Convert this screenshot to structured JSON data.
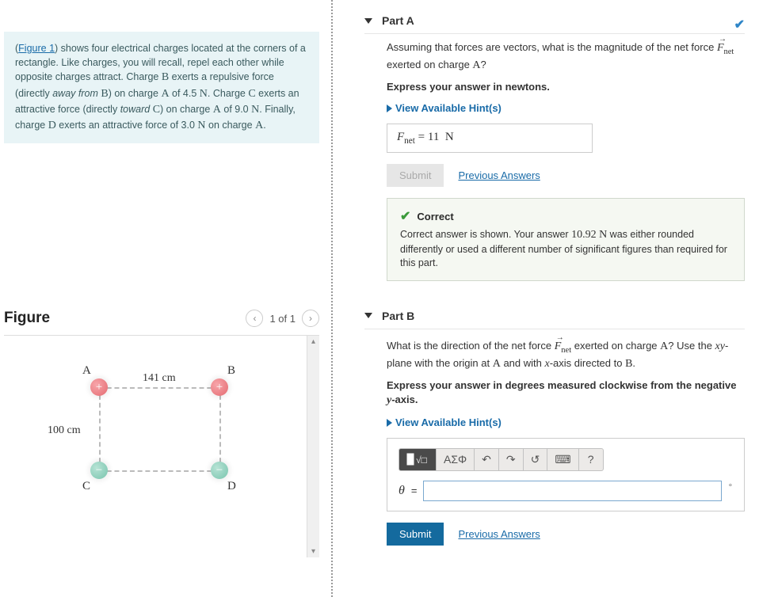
{
  "problem": {
    "figure_link": "Figure 1",
    "text_1": ") shows four electrical charges located at the corners of a rectangle. Like charges, you will recall, repel each other while opposite charges attract. Charge ",
    "B": "B",
    "text_2": " exerts a repulsive force (directly ",
    "away": "away from",
    "text_3": " ",
    "B2": "B",
    "text_4": ") on charge ",
    "A": "A",
    "text_5": " of 4.5 ",
    "N1": "N",
    "text_6": ". Charge ",
    "C": "C",
    "text_7": " exerts an attractive force (directly ",
    "toward": "toward",
    "text_8": " ",
    "C2": "C",
    "text_9": ") on charge ",
    "A2": "A",
    "text_10": " of 9.0 ",
    "N2": "N",
    "text_11": ". Finally, charge ",
    "D": "D",
    "text_12": " exerts an attractive force of 3.0 ",
    "N3": "N",
    "text_13": " on charge ",
    "A3": "A",
    "text_14": "."
  },
  "figure": {
    "title": "Figure",
    "pager": "1 of 1",
    "labels": {
      "A": "A",
      "B": "B",
      "C": "C",
      "D": "D"
    },
    "dim_top": "141 cm",
    "dim_left": "100 cm"
  },
  "partA": {
    "title": "Part A",
    "question_1": "Assuming that forces are vectors, what is the magnitude of the net force ",
    "question_2": " exerted on charge ",
    "question_3": "?",
    "chargeA": "A",
    "instruct": "Express your answer in newtons.",
    "hints": "View Available Hint(s)",
    "ans_prefix": "F",
    "ans_sub": "net",
    "ans_eq": " = ",
    "ans_val": "11",
    "ans_unit": " N",
    "submit": "Submit",
    "prev": "Previous Answers",
    "correct_title": "Correct",
    "correct_msg_1": "Correct answer is shown. Your answer ",
    "correct_val": "10.92 N",
    "correct_msg_2": " was either rounded differently or used a different number of significant figures than required for this part."
  },
  "partB": {
    "title": "Part B",
    "q1": "What is the direction of the net force ",
    "q2": " exerted on charge ",
    "chargeA": "A",
    "q3": "? Use the ",
    "xy": "xy",
    "q4": "-plane with the origin at ",
    "A2": "A",
    "q5": " and with ",
    "x": "x",
    "q6": "-axis directed to ",
    "B": "B",
    "q7": ".",
    "instruct": "Express your answer in degrees measured clockwise from the negative ",
    "yaxis": "y",
    "instruct2": "-axis.",
    "hints": "View Available Hint(s)",
    "greek_btn": "ΑΣΦ",
    "theta": "θ",
    "eq": " = ",
    "unit_deg": "∘",
    "submit": "Submit",
    "prev": "Previous Answers"
  },
  "toolbar_help": "?",
  "chart_data": {
    "type": "diagram",
    "description": "Four point charges at corners of a rectangle",
    "width_cm": 141,
    "height_cm": 100,
    "charges": [
      {
        "label": "A",
        "sign": "+",
        "corner": "top-left"
      },
      {
        "label": "B",
        "sign": "+",
        "corner": "top-right"
      },
      {
        "label": "C",
        "sign": "-",
        "corner": "bottom-left"
      },
      {
        "label": "D",
        "sign": "-",
        "corner": "bottom-right"
      }
    ],
    "forces_on_A_N": {
      "from_B": 4.5,
      "from_C": 9.0,
      "from_D": 3.0
    },
    "net_force_on_A_N": 11
  }
}
